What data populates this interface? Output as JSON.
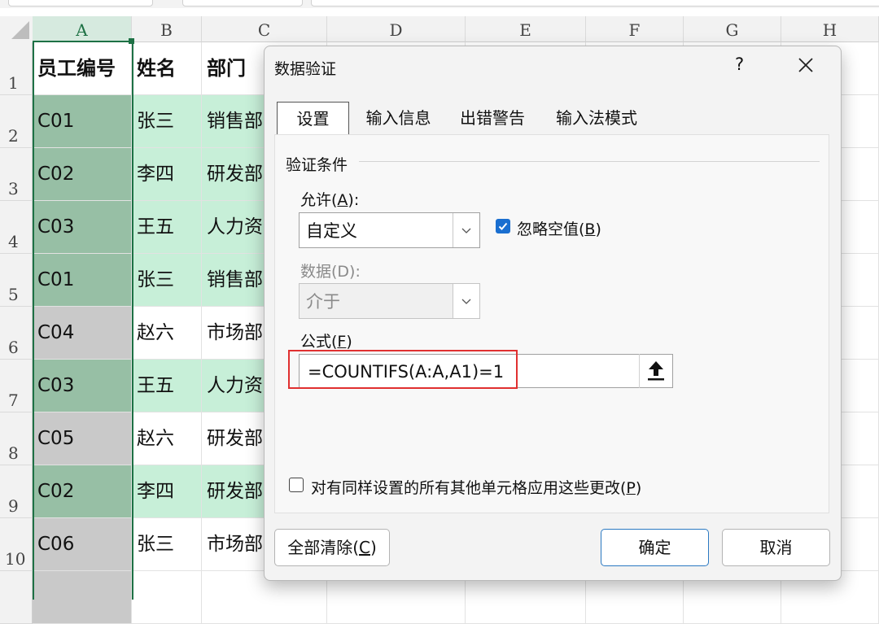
{
  "columns": [
    "A",
    "B",
    "C",
    "D",
    "E",
    "F",
    "G",
    "H"
  ],
  "rows": [
    "1",
    "2",
    "3",
    "4",
    "5",
    "6",
    "7",
    "8",
    "9",
    "10"
  ],
  "table": [
    {
      "id": "员工编号",
      "name": "姓名",
      "dept": "部门"
    },
    {
      "id": "C01",
      "name": "张三",
      "dept": "销售部"
    },
    {
      "id": "C02",
      "name": "李四",
      "dept": "研发部"
    },
    {
      "id": "C03",
      "name": "王五",
      "dept": "人力资"
    },
    {
      "id": "C01",
      "name": "张三",
      "dept": "销售部"
    },
    {
      "id": "C04",
      "name": "赵六",
      "dept": "市场部"
    },
    {
      "id": "C03",
      "name": "王五",
      "dept": "人力资"
    },
    {
      "id": "C05",
      "name": "赵六",
      "dept": "研发部"
    },
    {
      "id": "C02",
      "name": "李四",
      "dept": "研发部"
    },
    {
      "id": "C06",
      "name": "张三",
      "dept": "市场部"
    }
  ],
  "colors": {
    "selected_col_a": "#97bfa5",
    "selected_col_a_plain": "#c9c9c9",
    "highlight_bc": "#c7efd8",
    "selection_border": "#1e7145",
    "annotation_red": "#e03030",
    "checkbox_blue": "#1a6fd0"
  },
  "dialog": {
    "title": "数据验证",
    "help": "?",
    "close_icon": "close-icon",
    "tabs": [
      "设置",
      "输入信息",
      "出错警告",
      "输入法模式"
    ],
    "group_label": "验证条件",
    "allow_label_pre": "允许(",
    "allow_label_key": "A",
    "allow_label_post": "):",
    "allow_value": "自定义",
    "ignore_blank_pre": "忽略空值(",
    "ignore_blank_key": "B",
    "ignore_blank_post": ")",
    "ignore_blank_checked": true,
    "data_label": "数据(D):",
    "data_value": "介于",
    "formula_label_pre": "公式(",
    "formula_label_key": "F",
    "formula_label_post": ")",
    "formula_value": "=COUNTIFS(A:A,A1)=1",
    "apply_all_pre": "对有同样设置的所有其他单元格应用这些更改(",
    "apply_all_key": "P",
    "apply_all_post": ")",
    "apply_all_checked": false,
    "clear_pre": "全部清除(",
    "clear_key": "C",
    "clear_post": ")",
    "ok": "确定",
    "cancel": "取消"
  }
}
